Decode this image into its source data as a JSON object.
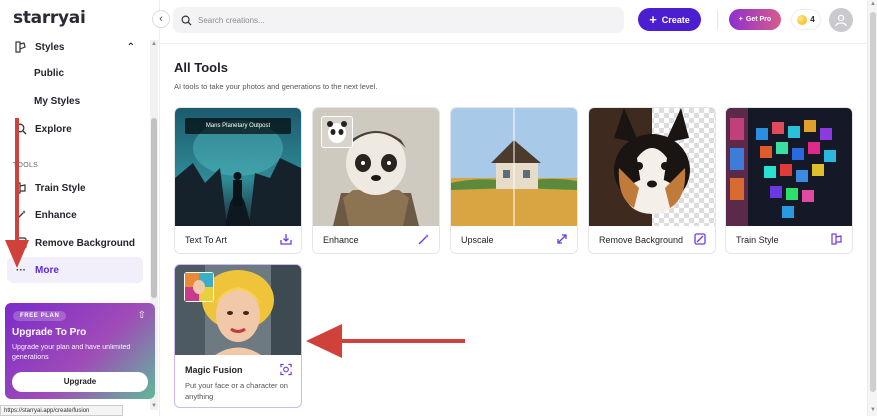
{
  "app": {
    "logo": "starryai"
  },
  "sidebar": {
    "styles_label": "Styles",
    "styles_sub": [
      "Public",
      "My Styles"
    ],
    "explore_label": "Explore",
    "tools_section": "TOOLS",
    "train_style_label": "Train Style",
    "enhance_label": "Enhance",
    "remove_bg_label": "Remove Background",
    "more_label": "More"
  },
  "promo": {
    "badge": "FREE  PLAN",
    "title": "Upgrade To Pro",
    "desc": "Upgrade your plan and have unlimited generations",
    "button": "Upgrade"
  },
  "status_url": "https://starryai.app/create/fusion",
  "header": {
    "search_placeholder": "Search creations...",
    "create_label": "Create",
    "get_pro_label": "Get Pro",
    "coin_count": "4"
  },
  "main": {
    "title": "All Tools",
    "subtitle": "AI tools to take your photos and generations to the next level.",
    "tools": [
      {
        "name": "Text To Art",
        "icon": "download-tray-icon",
        "caption": "Mans Planetary Outpost"
      },
      {
        "name": "Enhance",
        "icon": "magic-wand-icon"
      },
      {
        "name": "Upscale",
        "icon": "expand-arrow-icon"
      },
      {
        "name": "Remove Background",
        "icon": "eraser-icon"
      },
      {
        "name": "Train Style",
        "icon": "style-grid-icon"
      },
      {
        "name": "Magic Fusion",
        "icon": "face-scan-icon",
        "desc": "Put your face or a character on anything"
      }
    ]
  },
  "colors": {
    "accent": "#4b1fd1",
    "arrow": "#d0413a",
    "active_bg": "#f2effa"
  }
}
